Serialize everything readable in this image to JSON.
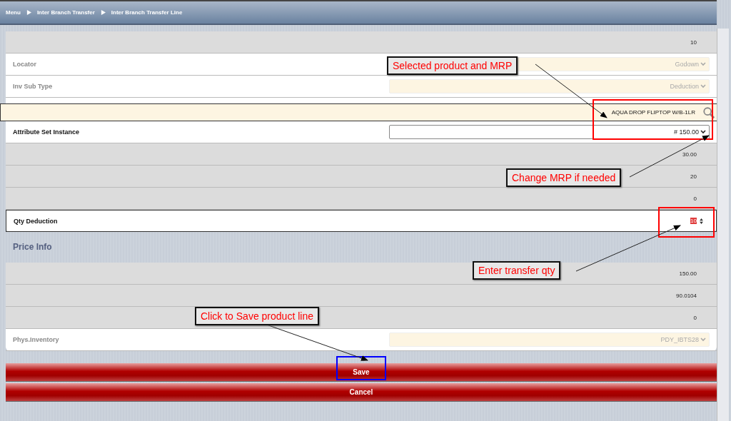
{
  "breadcrumb": [
    {
      "label": "Menu"
    },
    {
      "label": "Inter Branch Transfer"
    },
    {
      "label": "Inter Branch Transfer Line"
    }
  ],
  "fields": [
    {
      "kind": "readonly",
      "value": "10"
    },
    {
      "kind": "select",
      "label": "Locator",
      "value": "Godown",
      "disabled": true,
      "focused": false
    },
    {
      "kind": "select",
      "label": "Inv Sub Type",
      "value": "Deduction",
      "disabled": true,
      "focused": false
    },
    {
      "kind": "lookup",
      "value": "AQUA DROP FLIPTOP W/B-1LR",
      "focused": true
    },
    {
      "kind": "select",
      "label": "Attribute Set Instance",
      "value": "# 150.00",
      "disabled": false,
      "focused": false
    },
    {
      "kind": "readonly",
      "value": "30.00"
    },
    {
      "kind": "readonly",
      "value": "20"
    },
    {
      "kind": "readonly",
      "value": "0"
    },
    {
      "kind": "number",
      "label": "Qty Deduction",
      "value": "10",
      "focused": true,
      "text_selected": true
    }
  ],
  "price_info": {
    "heading": "Price Info",
    "fields": [
      {
        "kind": "readonly",
        "value": "150.00"
      },
      {
        "kind": "readonly",
        "value": "90.0104"
      },
      {
        "kind": "readonly",
        "value": "0"
      },
      {
        "kind": "select",
        "label": "Phys.Inventory",
        "value": "PDY_IBTS28",
        "disabled": true,
        "focused": false
      }
    ]
  },
  "buttons": [
    {
      "label": "Save"
    },
    {
      "label": "Cancel"
    }
  ],
  "annotations": [
    {
      "text": "Selected product and MRP"
    },
    {
      "text": "Change MRP if needed"
    },
    {
      "text": "Enter transfer qty"
    },
    {
      "text": "Click to Save product line"
    }
  ],
  "highlights": [
    {
      "color": "#ff0000"
    },
    {
      "color": "#ff0000"
    },
    {
      "color": "#0000ff"
    }
  ]
}
